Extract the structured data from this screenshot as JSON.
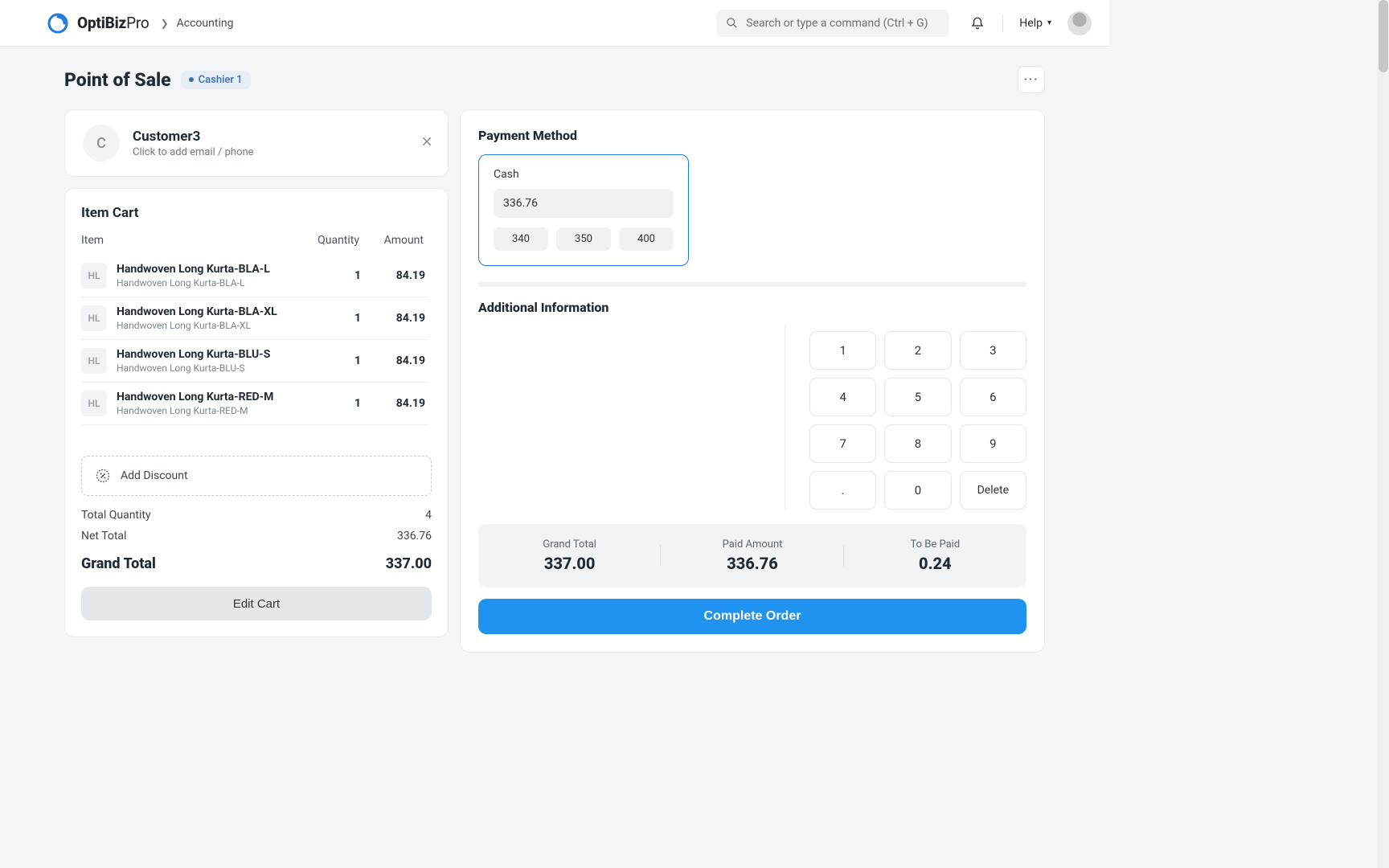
{
  "header": {
    "brand_bold": "OptiBiz",
    "brand_thin": "Pro",
    "crumb": "Accounting",
    "search_placeholder": "Search or type a command (Ctrl + G)",
    "help_label": "Help"
  },
  "page": {
    "title": "Point of Sale",
    "badge": "Cashier 1"
  },
  "customer": {
    "initial": "C",
    "name": "Customer3",
    "subtitle": "Click to add email / phone"
  },
  "cart": {
    "title": "Item Cart",
    "headers": {
      "item": "Item",
      "qty": "Quantity",
      "amount": "Amount"
    },
    "thumb_text": "HL",
    "items": [
      {
        "name": "Handwoven Long Kurta-BLA-L",
        "sku": "Handwoven Long Kurta-BLA-L",
        "qty": "1",
        "amount": "84.19"
      },
      {
        "name": "Handwoven Long Kurta-BLA-XL",
        "sku": "Handwoven Long Kurta-BLA-XL",
        "qty": "1",
        "amount": "84.19"
      },
      {
        "name": "Handwoven Long Kurta-BLU-S",
        "sku": "Handwoven Long Kurta-BLU-S",
        "qty": "1",
        "amount": "84.19"
      },
      {
        "name": "Handwoven Long Kurta-RED-M",
        "sku": "Handwoven Long Kurta-RED-M",
        "qty": "1",
        "amount": "84.19"
      }
    ],
    "discount_label": "Add Discount",
    "totals": {
      "total_qty_label": "Total Quantity",
      "total_qty": "4",
      "net_label": "Net Total",
      "net": "336.76",
      "grand_label": "Grand Total",
      "grand": "337.00"
    },
    "edit_label": "Edit Cart"
  },
  "payment": {
    "title": "Payment Method",
    "method_label": "Cash",
    "amount": "336.76",
    "quick": [
      "340",
      "350",
      "400"
    ],
    "additional_title": "Additional Information",
    "keypad": [
      "1",
      "2",
      "3",
      "4",
      "5",
      "6",
      "7",
      "8",
      "9",
      ".",
      "0",
      "Delete"
    ],
    "summary": {
      "grand_label": "Grand Total",
      "grand": "337.00",
      "paid_label": "Paid Amount",
      "paid": "336.76",
      "tbp_label": "To Be Paid",
      "tbp": "0.24"
    },
    "complete_label": "Complete Order"
  }
}
